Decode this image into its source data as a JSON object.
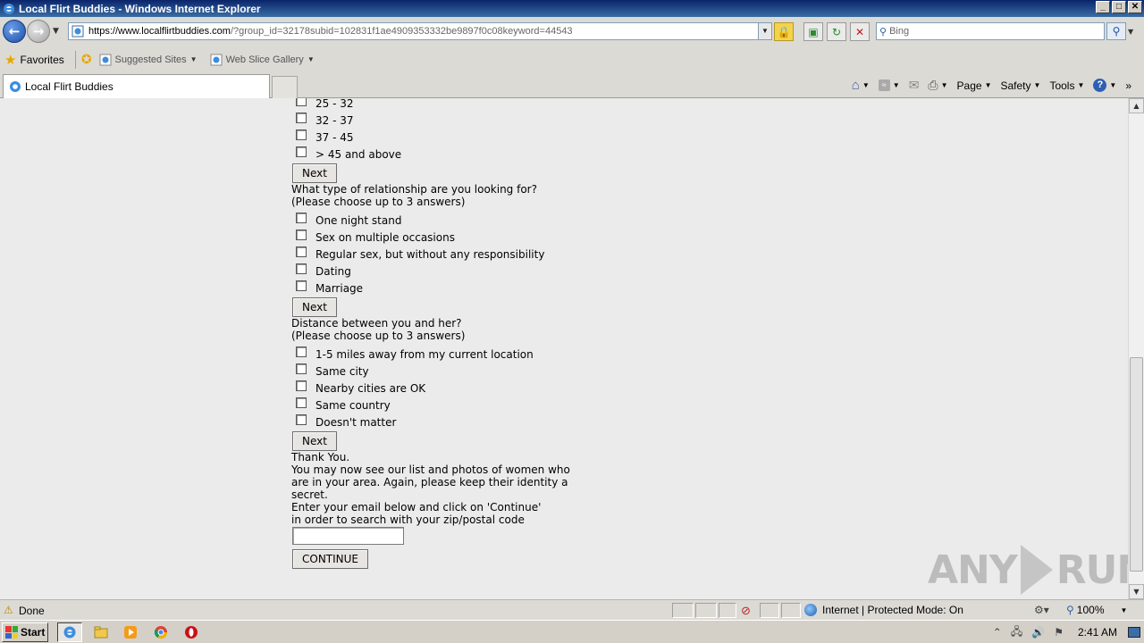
{
  "window": {
    "title": "Local Flirt Buddies - Windows Internet Explorer",
    "buttons": [
      "_",
      "□",
      "✕"
    ]
  },
  "address": {
    "url_main": "https://www.localflirtbuddies.com",
    "url_rest": "/?group_id=32178subid=102831f1ae4909353332be9897f0c08keyword=44543"
  },
  "search": {
    "placeholder": "Bing"
  },
  "favorites": {
    "label": "Favorites",
    "links": [
      "Suggested Sites",
      "Web Slice Gallery"
    ]
  },
  "tab": {
    "label": "Local Flirt Buddies"
  },
  "commands": [
    "Page",
    "Safety",
    "Tools"
  ],
  "form": {
    "age_options": [
      "25 - 32",
      "32 - 37",
      "37 - 45",
      "> 45 and above"
    ],
    "next_label": "Next",
    "q_relationship": "What type of relationship are you looking for?",
    "choose_note": "(Please choose up to 3 answers)",
    "relationship_options": [
      "One night stand",
      "Sex on multiple occasions",
      "Regular sex, but without any responsibility",
      "Dating",
      "Marriage"
    ],
    "q_distance": "Distance between you and her?",
    "distance_options": [
      "1-5 miles away from my current location",
      "Same city",
      "Nearby cities are OK",
      "Same country",
      "Doesn't matter"
    ],
    "thanks": "Thank You.",
    "message_lines": [
      "You may now see our list and photos of women who",
      "are in your area. Again, please keep their identity a",
      "secret."
    ],
    "email_lines": [
      "Enter your email below and click on 'Continue'",
      "in order to search with your zip/postal code"
    ],
    "email_value": "",
    "continue_label": "CONTINUE"
  },
  "watermark": {
    "left": "ANY",
    "right": "RUN"
  },
  "status": {
    "text": "Done",
    "zone": "Internet | Protected Mode: On",
    "zoom": "100%"
  },
  "taskbar": {
    "start": "Start",
    "clock": "2:41 AM"
  }
}
